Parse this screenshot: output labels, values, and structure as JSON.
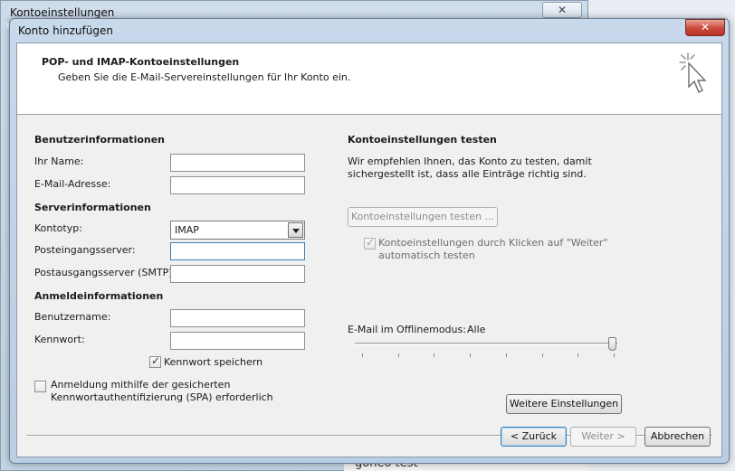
{
  "background_window": {
    "title": "Kontoeinstellungen",
    "close_glyph": "✕",
    "bottom_text": "goneo test"
  },
  "dialog": {
    "title": "Konto hinzufügen",
    "close_glyph": "✕"
  },
  "header": {
    "title": "POP- und IMAP-Kontoeinstellungen",
    "subtitle": "Geben Sie die E-Mail-Servereinstellungen für Ihr Konto ein.",
    "icon": "cursor-click-icon"
  },
  "user_info": {
    "section_title": "Benutzerinformationen",
    "name_label": "Ihr Name:",
    "name_value": "",
    "email_label": "E-Mail-Adresse:",
    "email_value": ""
  },
  "server_info": {
    "section_title": "Serverinformationen",
    "account_type_label": "Kontotyp:",
    "account_type_value": "IMAP",
    "incoming_label": "Posteingangsserver:",
    "incoming_value": "",
    "outgoing_label": "Postausgangsserver (SMTP):",
    "outgoing_value": ""
  },
  "login_info": {
    "section_title": "Anmeldeinformationen",
    "username_label": "Benutzername:",
    "username_value": "",
    "password_label": "Kennwort:",
    "password_value": "",
    "save_password_label": "Kennwort speichern",
    "save_password_checked": true,
    "spa_label_line1": "Anmeldung mithilfe der gesicherten",
    "spa_label_line2": "Kennwortauthentifizierung (SPA) erforderlich",
    "spa_checked": false
  },
  "test_settings": {
    "section_title": "Kontoeinstellungen testen",
    "description_line1": "Wir empfehlen Ihnen, das Konto zu testen, damit",
    "description_line2": "sichergestellt ist, dass alle Einträge richtig sind.",
    "test_button_label": "Kontoeinstellungen testen ...",
    "auto_test_label_line1": "Kontoeinstellungen durch Klicken auf \"Weiter\"",
    "auto_test_label_line2": "automatisch testen",
    "auto_test_checked": true
  },
  "offline": {
    "label": "E-Mail im Offlinemodus:",
    "value": "Alle",
    "slider_fraction": 1.0
  },
  "more_settings_button_label": "Weitere Einstellungen",
  "footer": {
    "back_label": "< Zurück",
    "next_label": "Weiter >",
    "cancel_label": "Abbrechen"
  },
  "colors": {
    "dialog_frame": "#b9cde3",
    "close_button": "#c9483a",
    "content_background": "#f0f0f0"
  }
}
